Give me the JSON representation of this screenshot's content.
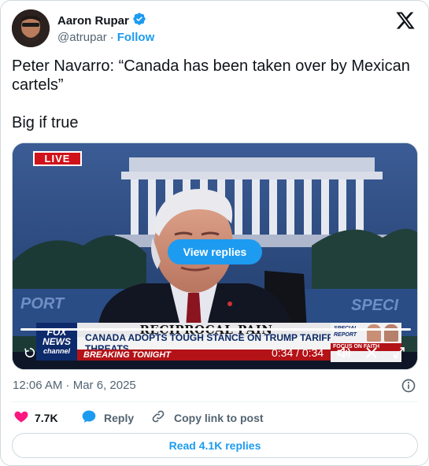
{
  "author": {
    "name": "Aaron Rupar",
    "handle": "@atrupar",
    "separator": "·",
    "follow_label": "Follow"
  },
  "icons": {
    "verified": "verified-badge-icon",
    "brand": "x-logo-icon",
    "info": "info-icon",
    "like": "heart-icon",
    "reply": "reply-bubble-icon",
    "copy_link": "link-icon",
    "replay": "replay-icon",
    "volume": "volume-icon",
    "expand": "expand-icon"
  },
  "tweet": {
    "line1": "Peter Navarro: “Canada has been taken over by Mexican cartels”",
    "line2": "Big if true"
  },
  "video": {
    "live_label": "LIVE",
    "view_replies_label": "View replies",
    "banner_title": "RECIPROCAL PAIN",
    "banner_sub": "CANADA ADOPTS TOUGH STANCE ON TRUMP TARIFF THREATS",
    "banner_breaking": "BREAKING TONIGHT",
    "network_line1": "FOX",
    "network_line2": "NEWS",
    "network_line3": "channel",
    "special_report": "SPECIAL REPORT",
    "focus_label": "FOCUS ON FAITH",
    "time_display": "0:34 / 0:34",
    "progress": 1.0
  },
  "meta": {
    "timestamp": "12:06 AM · Mar 6, 2025"
  },
  "actions": {
    "likes": "7.7K",
    "reply_label": "Reply",
    "copy_link_label": "Copy link to post"
  },
  "footer": {
    "read_replies_label": "Read 4.1K replies"
  },
  "colors": {
    "accent": "#1d9bf0",
    "like": "#f91880",
    "text": "#0f1419",
    "muted": "#536471",
    "border": "#cfd9de",
    "live": "#d0121b"
  }
}
